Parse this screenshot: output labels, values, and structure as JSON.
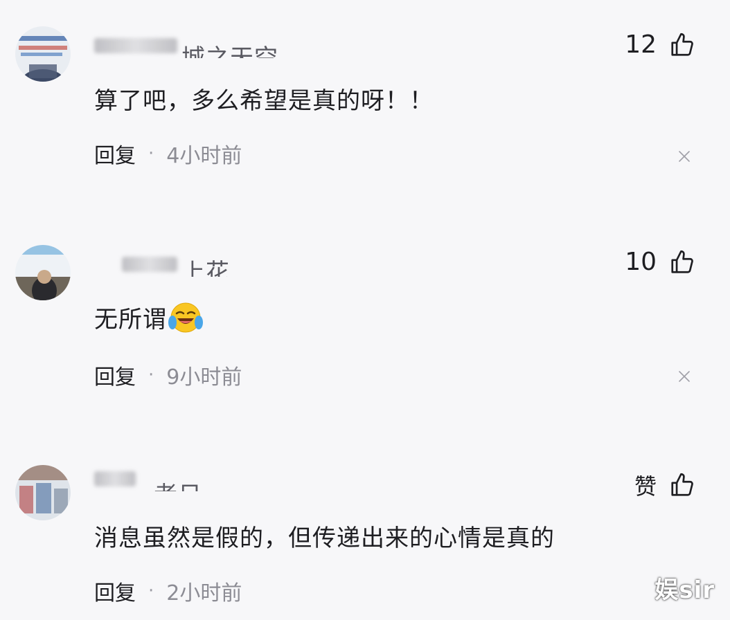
{
  "comments": [
    {
      "username": "城之天空",
      "like_count": "12",
      "text": "算了吧，多么希望是真的呀！！",
      "reply_label": "回复",
      "time": "4小时前",
      "has_emoji": false
    },
    {
      "username": "上花",
      "like_count": "10",
      "text": "无所谓",
      "emoji": "crying-laughing-emoji",
      "reply_label": "回复",
      "time": "9小时前",
      "has_emoji": true
    },
    {
      "username": "者日",
      "like_count": "赞",
      "text": "消息虽然是假的，但传递出来的心情是真的",
      "reply_label": "回复",
      "time": "2小时前",
      "has_emoji": false
    }
  ],
  "separator": "·",
  "watermark": "娱sir",
  "icons": {
    "like": "thumbs-up-icon",
    "close": "close-icon"
  },
  "colors": {
    "background": "#f7f7f9",
    "text": "#1e1e22",
    "muted": "#8c8c94"
  }
}
